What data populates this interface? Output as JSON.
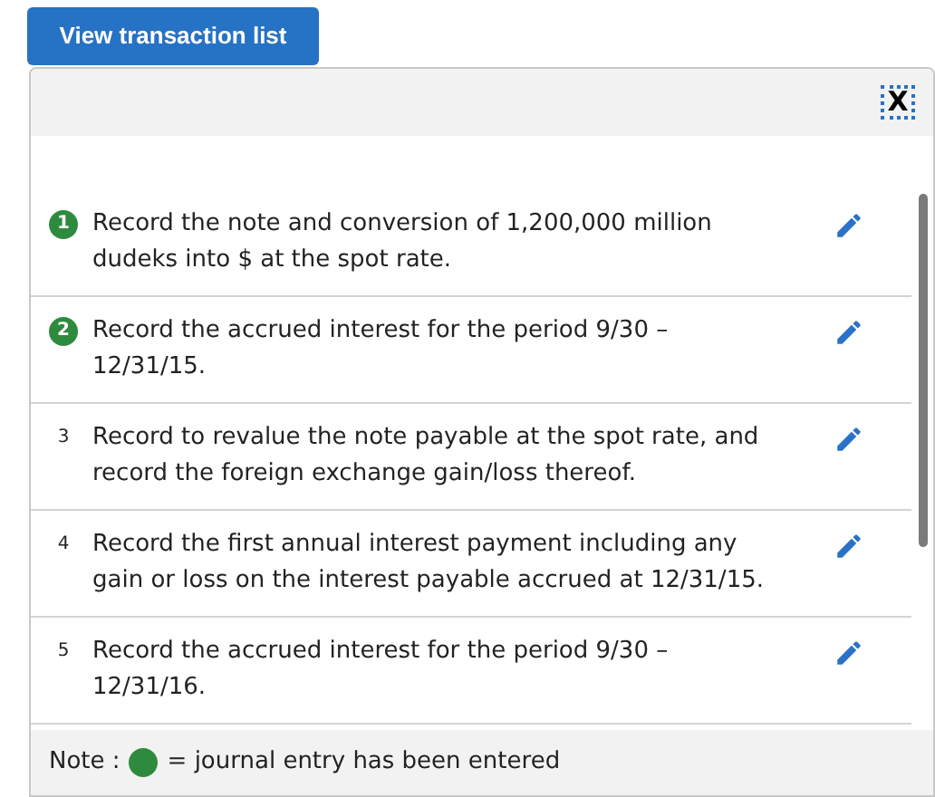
{
  "button": {
    "label": "View transaction list"
  },
  "close": {
    "label": "X"
  },
  "items": [
    {
      "number": "1",
      "entered": true,
      "text": "Record the note and conversion of 1,200,000 million dudeks into $ at the spot rate."
    },
    {
      "number": "2",
      "entered": true,
      "text": "Record the accrued interest for the period 9/30 – 12/31/15."
    },
    {
      "number": "3",
      "entered": false,
      "text": "Record to revalue the note payable at the spot rate, and record the foreign exchange gain/loss thereof."
    },
    {
      "number": "4",
      "entered": false,
      "text": "Record the first annual interest payment including any gain or loss on the interest payable accrued at 12/31/15."
    },
    {
      "number": "5",
      "entered": false,
      "text": "Record the accrued interest for the period 9/30 – 12/31/16."
    }
  ],
  "note": {
    "prefix": "Note :",
    "suffix": "= journal entry has been entered"
  }
}
